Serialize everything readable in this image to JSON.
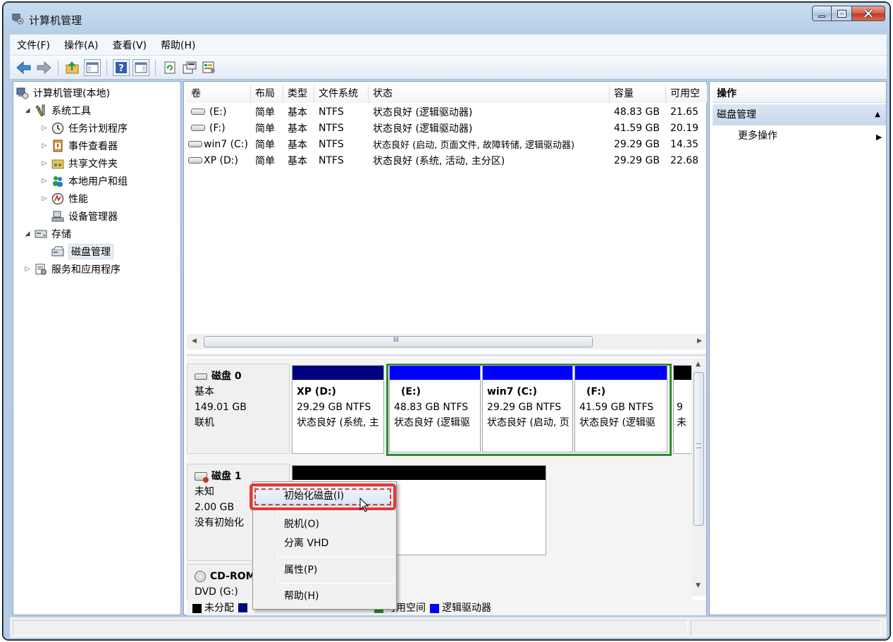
{
  "window": {
    "title": "计算机管理"
  },
  "menubar": {
    "items": [
      "文件(F)",
      "操作(A)",
      "查看(V)",
      "帮助(H)"
    ]
  },
  "toolbar": {
    "icons": [
      "back-icon",
      "forward-icon",
      "up-folder-icon",
      "show-hide-tree-icon",
      "help-icon",
      "show-hide-action-pane-icon",
      "refresh-icon",
      "properties-icon",
      "settings-icon"
    ]
  },
  "tree": {
    "root": "计算机管理(本地)",
    "items": [
      {
        "label": "系统工具",
        "level": 1,
        "toggle": "◢",
        "icon": "tools-icon"
      },
      {
        "label": "任务计划程序",
        "level": 2,
        "toggle": "▷",
        "icon": "clock-icon"
      },
      {
        "label": "事件查看器",
        "level": 2,
        "toggle": "▷",
        "icon": "event-viewer-icon"
      },
      {
        "label": "共享文件夹",
        "level": 2,
        "toggle": "▷",
        "icon": "shared-folder-icon"
      },
      {
        "label": "本地用户和组",
        "level": 2,
        "toggle": "▷",
        "icon": "users-icon"
      },
      {
        "label": "性能",
        "level": 2,
        "toggle": "▷",
        "icon": "performance-icon"
      },
      {
        "label": "设备管理器",
        "level": 2,
        "toggle": "",
        "icon": "device-manager-icon"
      },
      {
        "label": "存储",
        "level": 1,
        "toggle": "◢",
        "icon": "storage-icon"
      },
      {
        "label": "磁盘管理",
        "level": 2,
        "toggle": "",
        "icon": "disk-management-icon",
        "selected": true
      },
      {
        "label": "服务和应用程序",
        "level": 1,
        "toggle": "▷",
        "icon": "services-icon"
      }
    ]
  },
  "volume_list": {
    "columns": [
      "卷",
      "布局",
      "类型",
      "文件系统",
      "状态",
      "容量",
      "可用空"
    ],
    "rows": [
      [
        "(E:)",
        "简单",
        "基本",
        "NTFS",
        "状态良好 (逻辑驱动器)",
        "48.83 GB",
        "21.65"
      ],
      [
        "(F:)",
        "简单",
        "基本",
        "NTFS",
        "状态良好 (逻辑驱动器)",
        "41.59 GB",
        "20.19"
      ],
      [
        "win7 (C:)",
        "简单",
        "基本",
        "NTFS",
        "状态良好 (启动, 页面文件, 故障转储, 逻辑驱动器)",
        "29.29 GB",
        "14.35"
      ],
      [
        "XP (D:)",
        "简单",
        "基本",
        "NTFS",
        "状态良好 (系统, 活动, 主分区)",
        "29.29 GB",
        "22.68"
      ]
    ],
    "scroll_thumb_glyph": "III"
  },
  "disks": {
    "disk0": {
      "name": "磁盘 0",
      "type": "基本",
      "size": "149.01 GB",
      "status": "联机",
      "partitions": [
        {
          "name": "XP  (D:)",
          "size": "29.29 GB NTFS",
          "status": "状态良好 (系统, 主"
        },
        {
          "name": "(E:)",
          "size": "48.83 GB NTFS",
          "status": "状态良好 (逻辑驱"
        },
        {
          "name": "win7  (C:)",
          "size": "29.29 GB NTFS",
          "status": "状态良好 (启动, 页"
        },
        {
          "name": "(F:)",
          "size": "41.59 GB NTFS",
          "status": "状态良好 (逻辑驱"
        },
        {
          "name": "",
          "size": "9",
          "status": "未"
        }
      ]
    },
    "disk1": {
      "name": "磁盘 1",
      "type": "未知",
      "size": "2.00 GB",
      "status": "没有初始化"
    },
    "cdrom": {
      "name": "CD-ROM",
      "type": "DVD (G:)"
    }
  },
  "legend": {
    "unallocated": "未分配",
    "free_space": "可用空间",
    "logical": "逻辑驱动器"
  },
  "actions": {
    "header": "操作",
    "section": "磁盘管理",
    "more": "更多操作"
  },
  "context_menu": {
    "items": [
      "初始化磁盘(I)",
      "脱机(O)",
      "分离 VHD",
      "属性(P)",
      "帮助(H)"
    ]
  },
  "colors": {
    "primary_bar": "#0000c8",
    "logical_bar": "#0000ff",
    "unallocated": "#000000",
    "logical_group_border": "#2e8b2e",
    "highlight": "#e53935",
    "navy": "#000080"
  }
}
